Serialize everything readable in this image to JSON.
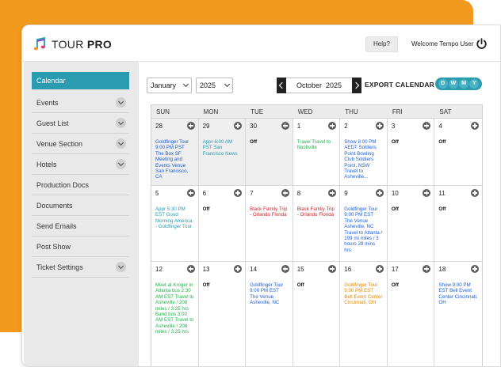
{
  "app": {
    "logo_word1": "TOUR",
    "logo_word2": "PRO",
    "help_label": "Help?",
    "welcome_text": "Welcome Tempo User",
    "icons": {
      "power": "power-icon",
      "add": "plus-circle-icon",
      "chevron": "chevron-down-icon"
    },
    "colors": {
      "accent": "#2b9bb0",
      "orange": "#f39a1e",
      "blue_event": "#1e5fd8",
      "teal_event": "#2b9bb0",
      "green_event": "#22b14c",
      "red_event": "#d2232a",
      "orange_event": "#e08a00"
    }
  },
  "sidebar": {
    "items": [
      {
        "label": "Calendar",
        "active": true,
        "dropdown": false
      },
      {
        "label": "Events",
        "active": false,
        "dropdown": true
      },
      {
        "label": "Guest List",
        "active": false,
        "dropdown": true
      },
      {
        "label": "Venue Section",
        "active": false,
        "dropdown": true
      },
      {
        "label": "Hotels",
        "active": false,
        "dropdown": true
      },
      {
        "label": "Production Docs",
        "active": false,
        "dropdown": false
      },
      {
        "label": "Documents",
        "active": false,
        "dropdown": false
      },
      {
        "label": "Send Emails",
        "active": false,
        "dropdown": false
      },
      {
        "label": "Post Show",
        "active": false,
        "dropdown": false
      },
      {
        "label": "Ticket Settings",
        "active": false,
        "dropdown": true
      }
    ]
  },
  "controls": {
    "month_select": "January",
    "year_select": "2025",
    "current_month": "October",
    "current_year": "2025",
    "export_label": "EXPORT CALENDAR",
    "views": [
      "D",
      "W",
      "M",
      "Y"
    ]
  },
  "calendar": {
    "weekdays": [
      "SUN",
      "MON",
      "TUE",
      "WED",
      "THU",
      "FRI",
      "SAT"
    ],
    "days": [
      {
        "num": "28",
        "other": true,
        "event": "Goldfinger Tour 9:00 PM PST The Box SF Meeting and Events Venue San Francisco, CA",
        "color": "#1e5fd8"
      },
      {
        "num": "29",
        "other": true,
        "event": "Appr 6:00 AM PST San Francisco News",
        "color": "#2b9bb0"
      },
      {
        "num": "30",
        "other": true,
        "event": "Off",
        "color": "#111111"
      },
      {
        "num": "1",
        "other": false,
        "event": "Travel Travel to Nashville",
        "color": "#22b14c"
      },
      {
        "num": "2",
        "other": false,
        "event": "Show 8:00 PM AEDT Soldiers Point Bowling Club Soldiers Point, NSW Travel to Asheville...",
        "color": "#1e5fd8"
      },
      {
        "num": "3",
        "other": false,
        "event": "Off",
        "color": "#111111"
      },
      {
        "num": "4",
        "other": false,
        "event": "Off",
        "color": "#111111"
      },
      {
        "num": "5",
        "other": false,
        "event": "Appr 5:30 PM EST Good Morning America - Goldfinger Tour",
        "color": "#2b9bb0"
      },
      {
        "num": "6",
        "other": false,
        "event": "Off",
        "color": "#111111"
      },
      {
        "num": "7",
        "other": false,
        "event": "Black Family Trip - Orlando Florida",
        "color": "#d2232a"
      },
      {
        "num": "8",
        "other": false,
        "event": "Black Family Trip - Orlando Florida",
        "color": "#d2232a"
      },
      {
        "num": "9",
        "other": false,
        "event": "Goldfinger Tour 9:00 PM EST The Venue Asheville, NC Travel to Atlanta / 199 mi miles / 3 hours 29 mins hrs",
        "color": "#1e5fd8"
      },
      {
        "num": "10",
        "other": false,
        "event": "Off",
        "color": "#111111"
      },
      {
        "num": "11",
        "other": false,
        "event": "Off",
        "color": "#111111"
      },
      {
        "num": "12",
        "other": false,
        "event": "Meet at Kroger in Atlanta bus 2:30 AM EST Travel to Asheville / 208 miles / 3.25 hrs Band bus 3:00 AM EST Travel to Asheville / 208 miles / 3.25 hrs",
        "color": "#22b14c"
      },
      {
        "num": "13",
        "other": false,
        "event": "Off",
        "color": "#111111"
      },
      {
        "num": "14",
        "other": false,
        "event": "Goldfinger Tour 9:00 PM EST The Venue Asheville, NC",
        "color": "#1e5fd8"
      },
      {
        "num": "15",
        "other": false,
        "event": "Off",
        "color": "#111111"
      },
      {
        "num": "16",
        "other": false,
        "event": "Goldfinger Tour 9:00 PM EST Bell Event Center Cincinnati, OH",
        "color": "#e08a00"
      },
      {
        "num": "17",
        "other": false,
        "event": "Off",
        "color": "#111111"
      },
      {
        "num": "18",
        "other": false,
        "event": "Show 9:00 PM EST Bell Event Center Cincinnati, OH",
        "color": "#1e5fd8"
      }
    ]
  }
}
